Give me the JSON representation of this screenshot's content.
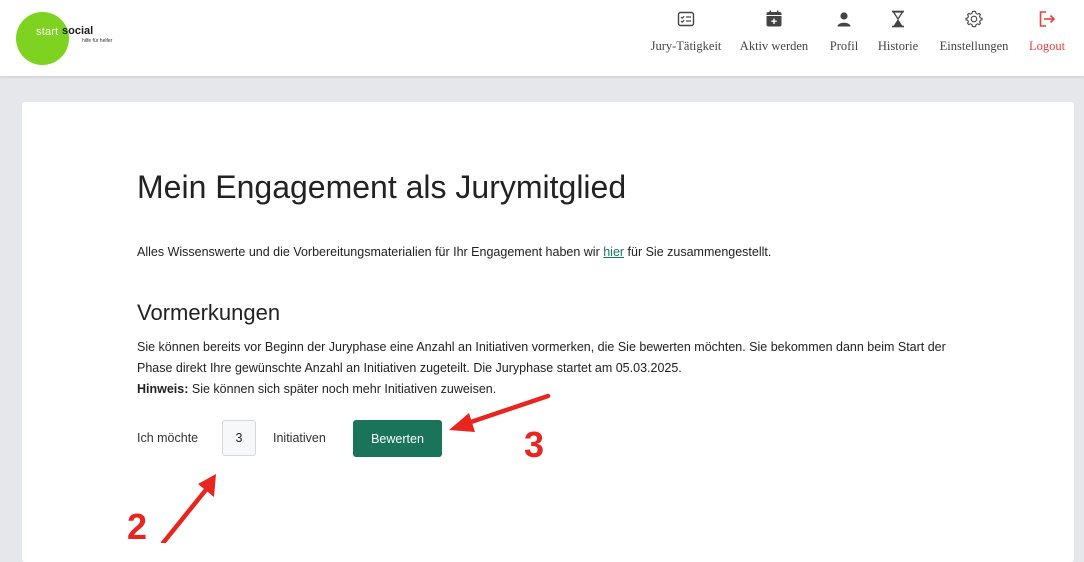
{
  "brand": {
    "start": "start",
    "social": "social",
    "tagline": "hilfe für helfer"
  },
  "nav": {
    "items": [
      {
        "label": "Jury-Tätigkeit",
        "icon": "checklist-icon"
      },
      {
        "label": "Aktiv werden",
        "icon": "calendar-plus-icon"
      },
      {
        "label": "Profil",
        "icon": "person-icon"
      },
      {
        "label": "Historie",
        "icon": "hourglass-icon"
      },
      {
        "label": "Einstellungen",
        "icon": "gear-icon"
      },
      {
        "label": "Logout",
        "icon": "logout-icon"
      }
    ]
  },
  "page": {
    "title": "Mein Engagement als Jurymitglied",
    "intro_before": "Alles Wissenswerte und die Vorbereitungsmaterialien für Ihr Engagement haben wir ",
    "intro_link": "hier",
    "intro_after": " für Sie zusammengestellt.",
    "section_title": "Vormerkungen",
    "paragraph": "Sie können bereits vor Beginn der Juryphase eine Anzahl an Initiativen vormerken, die Sie bewerten möchten. Sie bekommen dann beim Start der Phase direkt Ihre gewünschte Anzahl an Initiativen zugeteilt. Die Juryphase startet am 05.03.2025.",
    "hint_label": "Hinweis:",
    "hint_text": " Sie können sich später noch mehr Initiativen zuweisen."
  },
  "form": {
    "prefix_label": "Ich möchte",
    "quantity_value": "3",
    "suffix_label": "Initiativen",
    "submit_label": "Bewerten"
  },
  "annotations": {
    "marker_2": "2",
    "marker_3": "3"
  },
  "colors": {
    "brand_green": "#7ed321",
    "primary_button": "#19745a",
    "logout_red": "#e8413c",
    "annotation_red": "#e8251f"
  }
}
